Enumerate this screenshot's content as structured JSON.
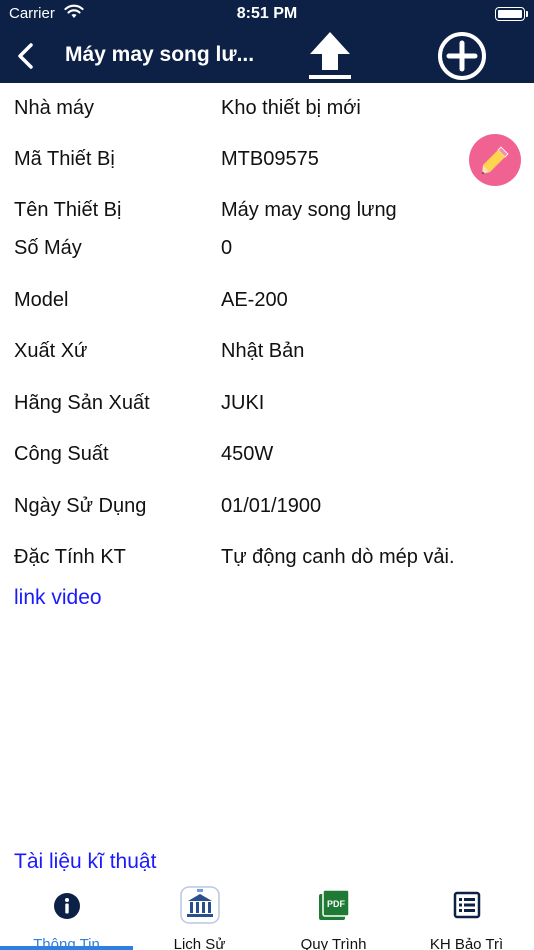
{
  "status_bar": {
    "carrier": "Carrier",
    "time": "8:51 PM"
  },
  "nav": {
    "title": "Máy may song lư..."
  },
  "fields": [
    {
      "label": "Nhà máy",
      "value": "Kho thiết bị mới"
    },
    {
      "label": "Mã Thiết Bị",
      "value": "MTB09575"
    },
    {
      "label": "Tên Thiết Bị",
      "value": "Máy may song lưng"
    },
    {
      "label": "Số Máy",
      "value": "0"
    },
    {
      "label": "Model",
      "value": "AE-200"
    },
    {
      "label": "Xuất Xứ",
      "value": "Nhật Bản"
    },
    {
      "label": "Hãng Sản Xuất",
      "value": "JUKI"
    },
    {
      "label": "Công Suất",
      "value": "450W"
    },
    {
      "label": "Ngày Sử Dụng",
      "value": "01/01/1900"
    },
    {
      "label": "Đặc Tính KT",
      "value": "Tự động canh dò mép vải."
    }
  ],
  "links": {
    "video": "link video",
    "tech_docs": "Tài liệu kĩ thuật"
  },
  "tabs": [
    {
      "label": "Thông Tin",
      "icon": "info-icon"
    },
    {
      "label": "Lịch Sử",
      "icon": "history-building-icon"
    },
    {
      "label": "Quy Trình",
      "icon": "pdf-icon"
    },
    {
      "label": "KH Bảo Trì",
      "icon": "list-icon"
    }
  ],
  "colors": {
    "header": "#0d2146",
    "active_tab": "#2f7fe0",
    "link": "#1a1aff",
    "edit_button": "#f06292",
    "pdf_green": "#1e7a34"
  }
}
